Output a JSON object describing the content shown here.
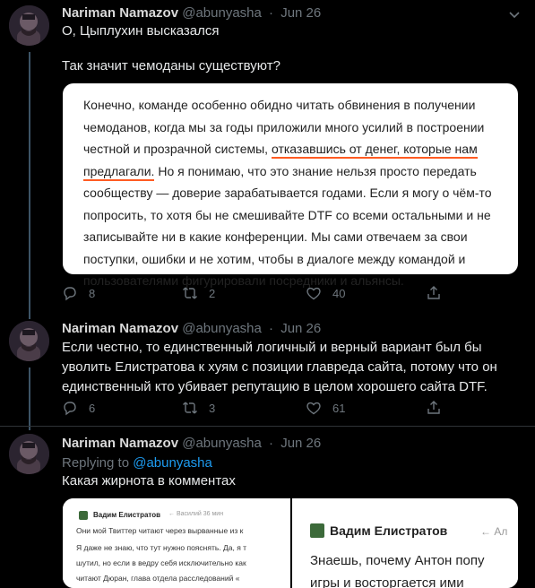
{
  "tweets": [
    {
      "author_name": "Nariman Namazov",
      "handle": "@abunyasha",
      "separator": "·",
      "date": "Jun 26",
      "text_lines": [
        "О, Цыплухин высказался",
        "Так значит чемоданы существуют?"
      ],
      "quote_lines": [
        {
          "before": "Конечно, команде особенно обидно читать обвинения в получении",
          "underlined": "",
          "after": ""
        },
        {
          "before": "чемоданов, когда мы за годы приложили много усилий в построении",
          "underlined": "",
          "after": ""
        },
        {
          "before": "честной и прозрачной системы, ",
          "underlined": "отказавшись от денег, которые нам",
          "after": ""
        },
        {
          "before": "",
          "underlined": "предлагали.",
          "after": " Но я понимаю, что это знание нельзя просто передать"
        },
        {
          "before": "сообществу — доверие зарабатывается годами. Если я могу о чём-то",
          "underlined": "",
          "after": ""
        },
        {
          "before": "попросить, то хотя бы не смешивайте DTF со всеми остальными и не",
          "underlined": "",
          "after": ""
        },
        {
          "before": "записывайте ни в какие конференции. Мы сами отвечаем за свои",
          "underlined": "",
          "after": ""
        },
        {
          "before": "поступки, ошибки и не хотим, чтобы в диалоге между командой и",
          "underlined": "",
          "after": ""
        },
        {
          "before": "пользователями фигурировали посредники и альянсы.",
          "underlined": "",
          "after": ""
        }
      ],
      "replies": "8",
      "retweets": "2",
      "likes": "40"
    },
    {
      "author_name": "Nariman Namazov",
      "handle": "@abunyasha",
      "separator": "·",
      "date": "Jun 26",
      "text_lines": [
        "Если честно, то единственный логичный и верный вариант был бы",
        "уволить Елистратова к хуям с позиции главреда сайта, потому что он",
        "единственный кто убивает репутацию в целом хорошего сайта DTF."
      ],
      "replies": "6",
      "retweets": "3",
      "likes": "61"
    },
    {
      "author_name": "Nariman Namazov",
      "handle": "@abunyasha",
      "separator": "·",
      "date": "Jun 26",
      "replying_label": "Replying to",
      "replying_handle": "@abunyasha",
      "text_lines": [
        "Какая жирнота в комментах"
      ],
      "media": {
        "left": {
          "name": "Вадим Елистратов",
          "meta": "← Василий   36 мин",
          "lines": [
            "Они мой Твиттер читают через вырванные из к",
            "Я даже не знаю, что тут нужно пояснять. Да, я т",
            "шутил, но если в ведру себя исключительно как",
            "читают Дюран, глава отдела расследований «"
          ]
        },
        "right": {
          "name": "Вадим Елистратов",
          "meta": "← Ал",
          "lines": [
            "Знаешь, почему Антон попу",
            "игры и восторгается ими"
          ]
        }
      }
    }
  ],
  "colors": {
    "background": "#000000",
    "text": "#e7e9ea",
    "muted": "#6e767d",
    "link": "#1d9bf0",
    "underline": "#ff5b22",
    "card": "#ffffff"
  },
  "icons": [
    "chevron-down-icon",
    "reply-icon",
    "retweet-icon",
    "like-icon",
    "share-icon",
    "avatar"
  ]
}
